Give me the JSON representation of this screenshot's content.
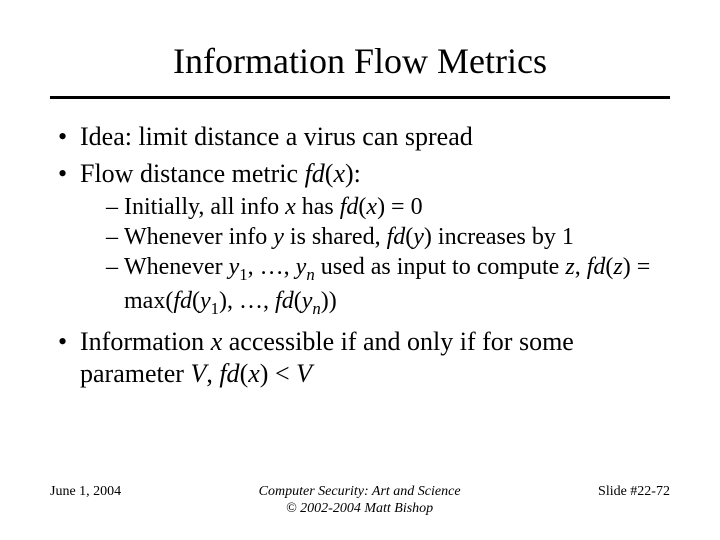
{
  "title": "Information Flow Metrics",
  "bullets": {
    "b1": "Idea: limit distance a virus can spread",
    "b2_prefix": "Flow distance metric ",
    "b2_fdx_f": "fd",
    "b2_fdx_paren": "(",
    "b2_fdx_x": "x",
    "b2_fdx_close": "):",
    "b3_prefix": "Information ",
    "b3_x": "x",
    "b3_mid": " accessible if and only if for some parameter ",
    "b3_V": "V",
    "b3_comma": ", ",
    "b3_fd": "fd",
    "b3_open": "(",
    "b3_x2": "x",
    "b3_close": ") < ",
    "b3_V2": "V"
  },
  "sub": {
    "s1_a": "Initially, all info ",
    "s1_x": "x",
    "s1_b": " has ",
    "s1_fd": "fd",
    "s1_open": "(",
    "s1_x2": "x",
    "s1_close": ") = 0",
    "s2_a": "Whenever info ",
    "s2_y": "y",
    "s2_b": " is shared, ",
    "s2_fd": "fd",
    "s2_open": "(",
    "s2_y2": "y",
    "s2_close": ") increases by 1",
    "s3_a": "Whenever ",
    "s3_y": "y",
    "s3_1": "1",
    "s3_b": ", …, ",
    "s3_y2": "y",
    "s3_n": "n",
    "s3_c": " used as input to compute ",
    "s3_z": "z",
    "s3_d": ", ",
    "s3_fd": "fd",
    "s3_open": "(",
    "s3_z2": "z",
    "s3_close": ") = max(",
    "s3_fd2": "fd",
    "s3_open2": "(",
    "s3_y3": "y",
    "s3_12": "1",
    "s3_e": "), …, ",
    "s3_fd3": "fd",
    "s3_open3": "(",
    "s3_y4": "y",
    "s3_n2": "n",
    "s3_close2": "))"
  },
  "footer": {
    "date": "June 1, 2004",
    "center1": "Computer Security: Art and Science",
    "center2": "© 2002-2004 Matt Bishop",
    "right": "Slide #22-72"
  }
}
